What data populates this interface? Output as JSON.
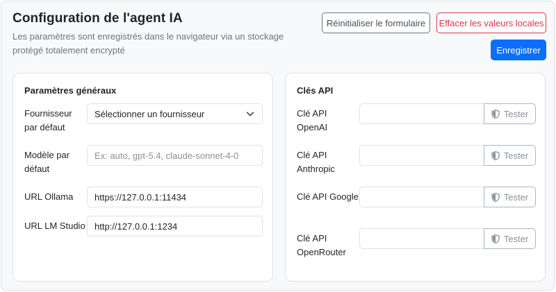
{
  "header": {
    "title": "Configuration de l'agent IA",
    "subtitle": "Les paramètres sont enregistrés dans le navigateur via un stockage protégé totalement encrypté",
    "reset_label": "Réinitialiser le formulaire",
    "clear_label": "Effacer les valeurs locales",
    "save_label": "Enregistrer"
  },
  "general": {
    "title": "Paramètres généraux",
    "provider": {
      "label": "Fournisseur par défaut",
      "selected": "Sélectionner un fournisseur"
    },
    "model": {
      "label": "Modèle par défaut",
      "value": "",
      "placeholder": "Ex: auto, gpt-5.4, claude-sonnet-4-0"
    },
    "ollama": {
      "label": "URL Ollama",
      "value": "https://127.0.0.1:11434"
    },
    "lmstudio": {
      "label": "URL LM Studio",
      "value": "http://127.0.0.1:1234"
    }
  },
  "api_keys": {
    "title": "Clés API",
    "test_label": "Tester",
    "items": [
      {
        "label": "Clé API OpenAI",
        "value": ""
      },
      {
        "label": "Clé API Anthropic",
        "value": ""
      },
      {
        "label": "Clé API Google",
        "value": ""
      },
      {
        "label": "Clé API OpenRouter",
        "value": ""
      }
    ]
  },
  "icons": {
    "select": "chevron-down-icon",
    "test": "shield-icon"
  },
  "colors": {
    "primary": "#0d6efd",
    "danger": "#dc3545",
    "secondary": "#6c757d"
  }
}
